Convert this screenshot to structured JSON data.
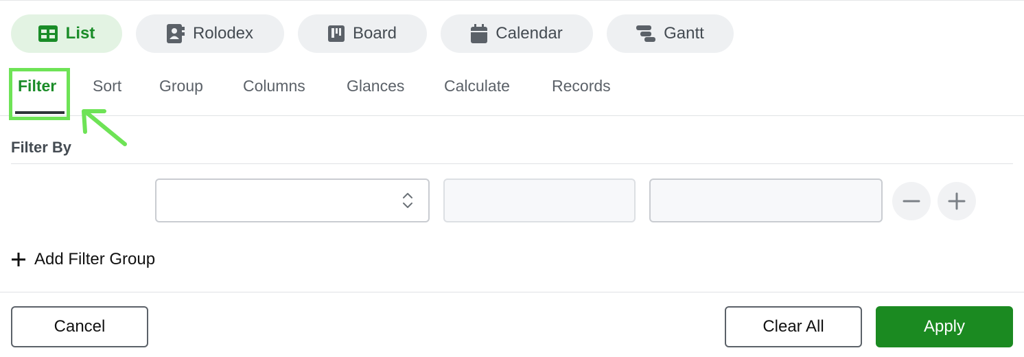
{
  "views": [
    {
      "label": "List",
      "icon": "table-icon",
      "active": true
    },
    {
      "label": "Rolodex",
      "icon": "contact-card-icon",
      "active": false
    },
    {
      "label": "Board",
      "icon": "kanban-board-icon",
      "active": false
    },
    {
      "label": "Calendar",
      "icon": "calendar-icon",
      "active": false
    },
    {
      "label": "Gantt",
      "icon": "gantt-icon",
      "active": false
    }
  ],
  "tabs": [
    {
      "label": "Filter",
      "active": true
    },
    {
      "label": "Sort"
    },
    {
      "label": "Group"
    },
    {
      "label": "Columns"
    },
    {
      "label": "Glances"
    },
    {
      "label": "Calculate"
    },
    {
      "label": "Records"
    }
  ],
  "filter": {
    "heading": "Filter By",
    "field_value": "",
    "operator_value": "",
    "criteria_value": "",
    "add_group_label": "Add Filter Group"
  },
  "footer": {
    "cancel_label": "Cancel",
    "clear_label": "Clear All",
    "apply_label": "Apply"
  },
  "colors": {
    "accent": "#1a8c28",
    "active_pill_bg": "#e3f3e3",
    "highlight": "#6ee356",
    "apply_bg": "#1b8a21"
  }
}
